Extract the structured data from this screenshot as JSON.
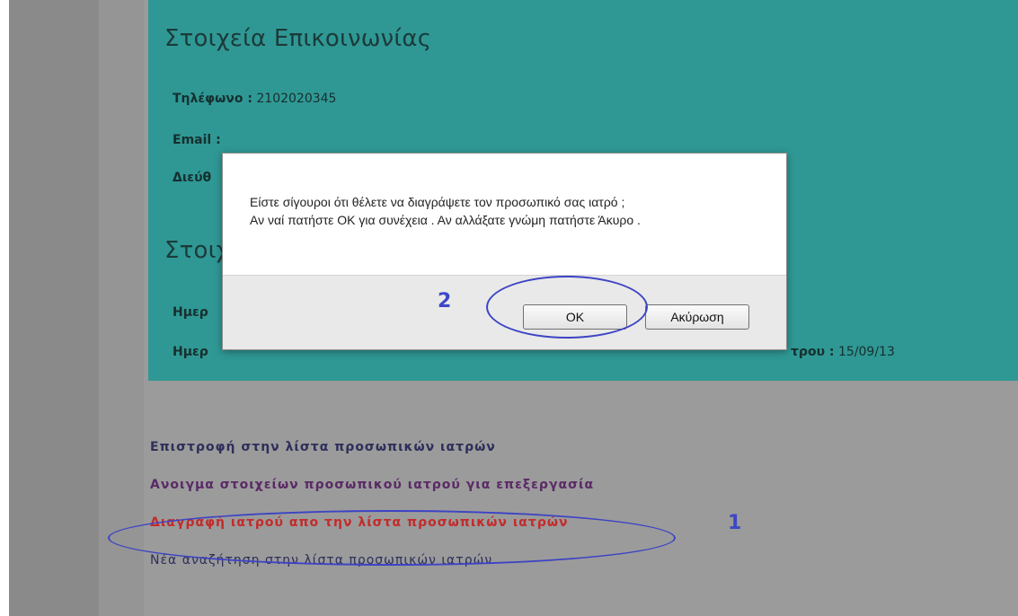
{
  "contact": {
    "title": "Στοιχεία Επικοινωνίας",
    "phone_label": "Τηλέφωνο :",
    "phone_value": "2102020345",
    "email_label": "Email :",
    "address_label_partial": "Διεύθ",
    "section2_title_partial": "Στοιχ",
    "date1_label_partial": "Ημερ",
    "date2_label_partial": "Ημερ",
    "date2_suffix": "τρου :",
    "date2_value": "15/09/13"
  },
  "links": {
    "back": "Επιστροφή στην λίστα προσωπικών ιατρών",
    "edit": "Ανοιγμα στοιχείων προσωπικού ιατρού για επεξεργασία",
    "delete": "Διαγραφή ιατρού απο την λίστα προσωπικών ιατρών",
    "new_search": "Νέα αναζήτηση στην λίστα προσωπικών ιατρών"
  },
  "dialog": {
    "line1": "Είστε σίγουροι ότι θέλετε να διαγράψετε τον προσωπικό σας ιατρό ;",
    "line2": "Αν ναί πατήστε OK για συνέχεια . Αν αλλάξατε γνώμη πατήστε Άκυρο .",
    "ok_label": "OK",
    "cancel_label": "Ακύρωση"
  },
  "annotations": {
    "step1": "1",
    "step2": "2",
    "color": "#3d43c4"
  },
  "colors": {
    "panel": "#2f9894",
    "background": "#9b9b9b",
    "delete_link": "#c32b2b"
  }
}
